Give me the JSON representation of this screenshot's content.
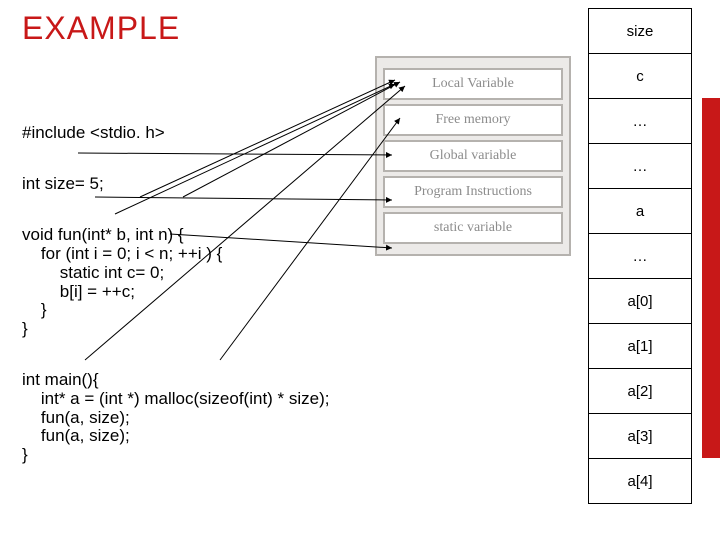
{
  "title": "EXAMPLE",
  "memory_layout": {
    "items": [
      "Local Variable",
      "Free memory",
      "Global variable",
      "Program Instructions",
      "static variable"
    ]
  },
  "stack_cells": [
    "size",
    "c",
    "…",
    "…",
    "a",
    "…",
    "a[0]",
    "a[1]",
    "a[2]",
    "a[3]",
    "a[4]"
  ],
  "code": {
    "l0": "#include <stdio. h>",
    "l1": "int size= 5;",
    "l2": "void fun(int* b, int n) {",
    "l3": "    for (int i = 0; i < n; ++i ) {",
    "l4": "        static int c= 0;",
    "l5": "        b[i] = ++c;",
    "l6": "    }",
    "l7": "}",
    "l8": "int main(){",
    "l9": "    int* a = (int *) malloc(sizeof(int) * size);",
    "l10": "    fun(a, size);",
    "l11": "    fun(a, size);",
    "l12": "}"
  },
  "chart_data": {
    "type": "diagram",
    "title": "C memory layout example",
    "mappings": [
      {
        "from_code": "int* b",
        "to_region": "Local Variable"
      },
      {
        "from_code": "int n",
        "to_region": "Local Variable"
      },
      {
        "from_code": "int i",
        "to_region": "Local Variable"
      },
      {
        "from_code": "int size=5",
        "to_region": "Global variable"
      },
      {
        "from_code": "static int c=0",
        "to_region": "static variable"
      },
      {
        "from_code": "int* a",
        "to_region": "Local Variable"
      },
      {
        "from_code": "malloc(sizeof(int)*size)",
        "to_region": "Free memory"
      },
      {
        "from_code": "void fun body",
        "to_region": "Program Instructions"
      }
    ],
    "right_column_description": "illustrative memory cells: globals (size, c), locals (a), and heap array a[0]..a[4]"
  }
}
